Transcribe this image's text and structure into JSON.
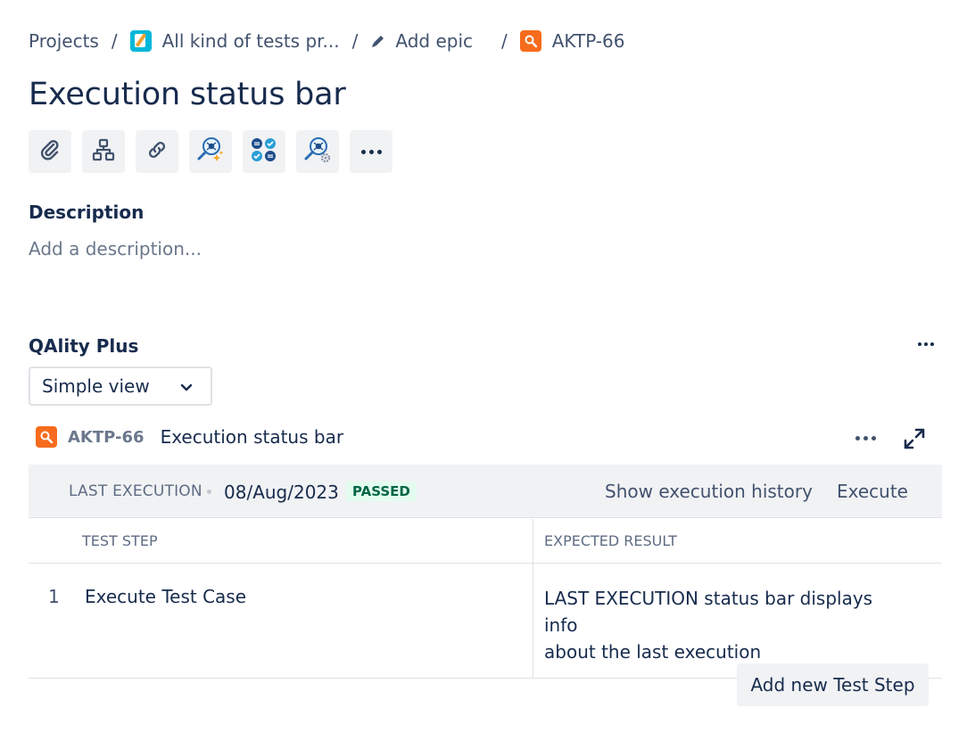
{
  "breadcrumb": {
    "projects": "Projects",
    "project_name": "All kind of tests pr...",
    "add_epic": "Add epic",
    "issue_key": "AKTP-66",
    "separator": "/"
  },
  "issue": {
    "title": "Execution status bar"
  },
  "toolbar": {
    "icons": [
      "paperclip-icon",
      "hierarchy-icon",
      "link-icon",
      "ai-search-icon",
      "checklist-icon",
      "bug-search-icon",
      "more-icon"
    ]
  },
  "description": {
    "label": "Description",
    "placeholder": "Add a description..."
  },
  "qality": {
    "title": "QAlity Plus",
    "view_select": "Simple view",
    "issue_key": "AKTP-66",
    "issue_summary": "Execution status bar",
    "last_execution": {
      "label": "LAST EXECUTION",
      "date": "08/Aug/2023",
      "status": "PASSED",
      "history_link": "Show execution history",
      "execute_link": "Execute"
    },
    "table": {
      "headers": [
        "TEST STEP",
        "EXPECTED RESULT"
      ],
      "rows": [
        {
          "number": "1",
          "step": "Execute Test Case",
          "expected_line1": "LAST EXECUTION status bar displays info",
          "expected_line2": "about the last execution"
        }
      ]
    },
    "add_step_button": "Add new Test Step"
  },
  "colors": {
    "accent_text": "#172b4d",
    "passed_bg": "#e3fcef",
    "passed_text": "#006644",
    "issue_icon": "#f76b1c",
    "project_icon": "#00b8d9",
    "bar_bg": "#f1f2f4"
  }
}
